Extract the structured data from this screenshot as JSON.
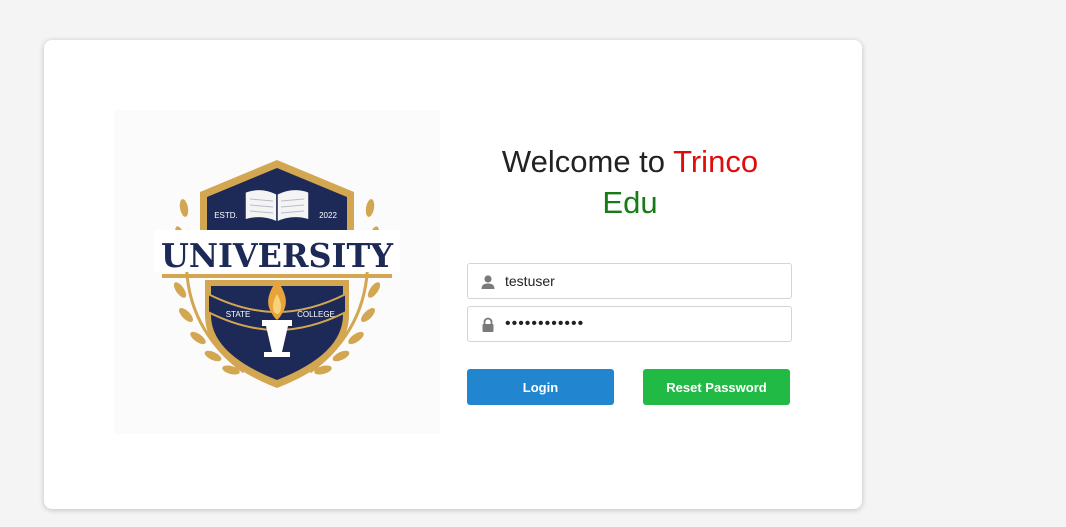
{
  "logo": {
    "estd_label": "ESTD.",
    "year": "2022",
    "name": "UNIVERSITY",
    "ribbon_left": "STATE",
    "ribbon_right": "COLLEGE"
  },
  "welcome": {
    "prefix": "Welcome to ",
    "brand_first": "Trinco",
    "brand_second": "Edu"
  },
  "form": {
    "username_value": "testuser",
    "password_value": "••••••••••••"
  },
  "buttons": {
    "login_label": "Login",
    "reset_label": "Reset Password"
  },
  "icons": {
    "username": "user-icon",
    "password": "lock-icon"
  },
  "colors": {
    "brand_red": "#e10b0b",
    "brand_green": "#177b17",
    "login_button": "#2285d0",
    "reset_button": "#21ba45",
    "logo_navy": "#1d2a57",
    "logo_gold": "#d3a652"
  }
}
